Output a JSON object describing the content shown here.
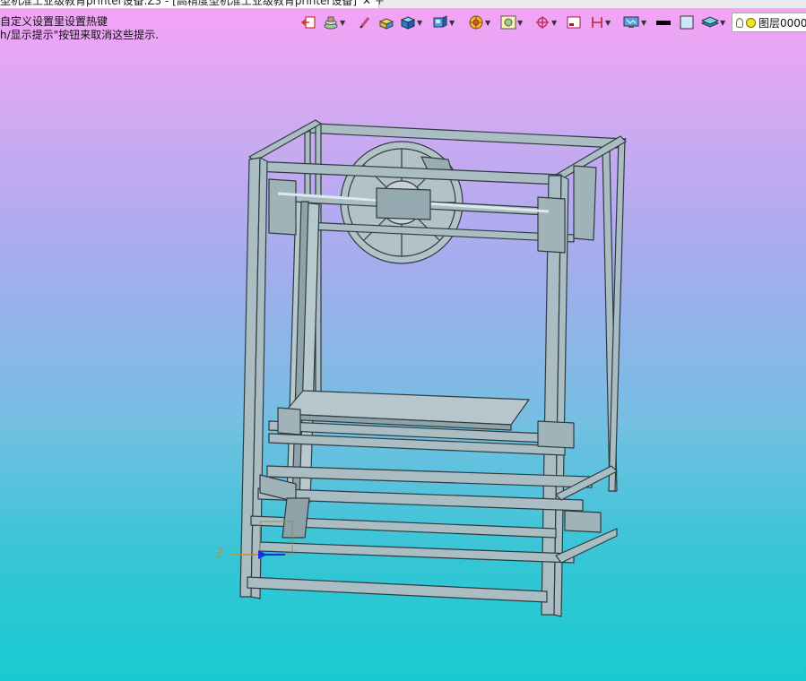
{
  "window": {
    "tab_title": "型机准工业级教育printer设备.Z3 - [高精度型机准工业级教育printer设备]",
    "close_glyph": "✕",
    "new_tab_glyph": "+"
  },
  "hints": {
    "line1": "自定义设置里设置热键",
    "line2": "h/显示提示\"按钮来取消这些提示."
  },
  "toolbar": {
    "buttons": [
      {
        "name": "exit-icon",
        "has_menu": false
      },
      {
        "name": "stack-icon",
        "has_menu": true
      },
      {
        "name": "pen-icon",
        "has_menu": false
      },
      {
        "name": "block-yellow-icon",
        "has_menu": false
      },
      {
        "name": "cube-blue-icon",
        "has_menu": true
      },
      {
        "name": "cube-view-icon",
        "has_menu": true
      },
      {
        "name": "render-mode-icon",
        "has_menu": true
      },
      {
        "name": "zoom-fit-icon",
        "has_menu": true
      },
      {
        "name": "target-icon",
        "has_menu": true
      },
      {
        "name": "window-icon",
        "has_menu": false
      },
      {
        "name": "bracket-icon",
        "has_menu": true
      },
      {
        "name": "display-icon",
        "has_menu": true
      },
      {
        "name": "line-black-icon",
        "has_menu": false
      },
      {
        "name": "fill-box-icon",
        "has_menu": false
      },
      {
        "name": "layers-icon",
        "has_menu": true
      }
    ],
    "layer_label": "图层0000"
  },
  "triad": {
    "z_label": "Z"
  },
  "colors": {
    "frame_fill": "#a9bdc3",
    "frame_edge": "#2f3b40",
    "bed_fill": "#b6c6cb",
    "axis_z": "#d38a1e",
    "axis_blue": "#1a2fe0"
  }
}
